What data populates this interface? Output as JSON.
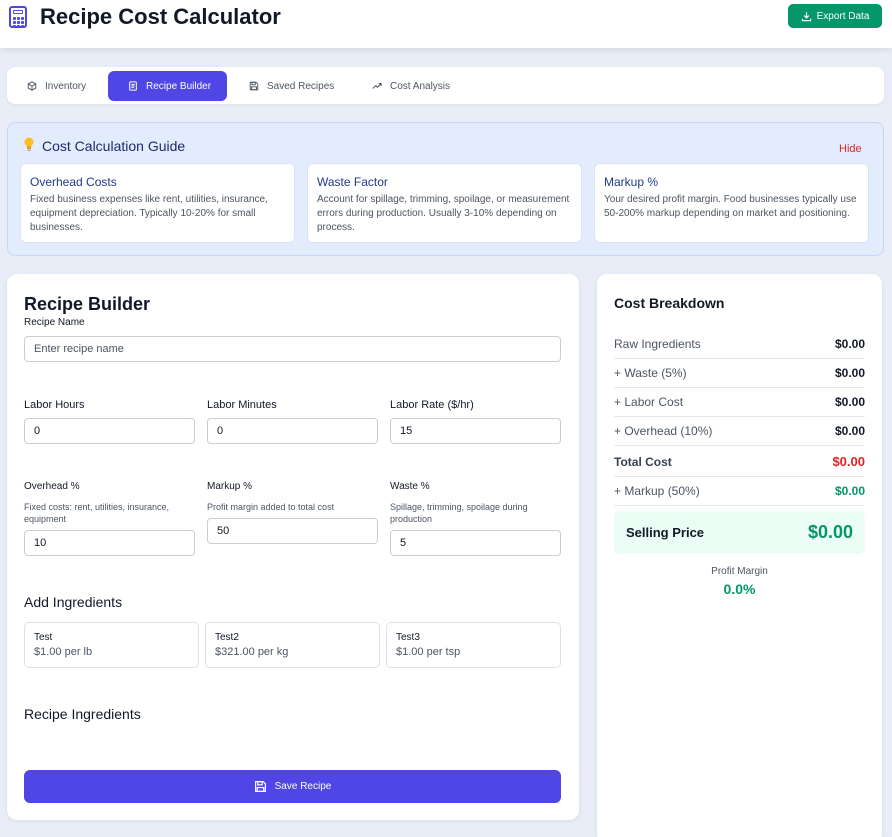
{
  "header": {
    "title": "Recipe Cost Calculator",
    "export_label": "Export Data",
    "export_color": "#059669"
  },
  "tabs": [
    {
      "label": "Inventory",
      "icon": "box-icon",
      "active": false
    },
    {
      "label": "Recipe Builder",
      "icon": "notebook-icon",
      "active": true
    },
    {
      "label": "Saved Recipes",
      "icon": "save-icon",
      "active": false
    },
    {
      "label": "Cost Analysis",
      "icon": "trending-up-icon",
      "active": false
    }
  ],
  "guide": {
    "title": "Cost Calculation Guide",
    "hide_label": "Hide",
    "cards": [
      {
        "title": "Overhead Costs",
        "text": "Fixed business expenses like rent, utilities, insurance, equipment depreciation. Typically 10-20% for small businesses."
      },
      {
        "title": "Waste Factor",
        "text": "Account for spillage, trimming, spoilage, or measurement errors during production. Usually 3-10% depending on process."
      },
      {
        "title": "Markup %",
        "text": "Your desired profit margin. Food businesses typically use 50-200% markup depending on market and positioning."
      }
    ]
  },
  "builder": {
    "title": "Recipe Builder",
    "recipe_name_label": "Recipe Name",
    "recipe_name_placeholder": "Enter recipe name",
    "labor_hours_label": "Labor Hours",
    "labor_hours_value": "0",
    "labor_minutes_label": "Labor Minutes",
    "labor_minutes_value": "0",
    "labor_rate_label": "Labor Rate ($/hr)",
    "labor_rate_value": "15",
    "overhead_label": "Overhead %",
    "overhead_hint": "Fixed costs: rent, utilities, insurance, equipment",
    "overhead_value": "10",
    "markup_label": "Markup %",
    "markup_hint": "Profit margin added to total cost",
    "markup_value": "50",
    "waste_label": "Waste %",
    "waste_hint": "Spillage, trimming, spoilage during production",
    "waste_value": "5",
    "add_ingredients_title": "Add Ingredients",
    "ingredients": [
      {
        "name": "Test",
        "price": "$1.00 per lb"
      },
      {
        "name": "Test2",
        "price": "$321.00 per kg"
      },
      {
        "name": "Test3",
        "price": "$1.00 per tsp"
      }
    ],
    "recipe_ingredients_title": "Recipe Ingredients",
    "save_label": "Save Recipe",
    "accent_color": "#4f46e5"
  },
  "breakdown": {
    "title": "Cost Breakdown",
    "rows": [
      {
        "label": "Raw Ingredients",
        "value": "$0.00"
      },
      {
        "label": "+ Waste (5%)",
        "value": "$0.00"
      },
      {
        "label": "+ Labor Cost",
        "value": "$0.00"
      },
      {
        "label": "+ Overhead (10%)",
        "value": "$0.00"
      },
      {
        "label": "Total Cost",
        "value": "$0.00"
      },
      {
        "label": "+ Markup (50%)",
        "value": "$0.00"
      }
    ],
    "selling_price_label": "Selling Price",
    "selling_price_value": "$0.00",
    "profit_margin_label": "Profit Margin",
    "profit_margin_value": "0.0%"
  }
}
